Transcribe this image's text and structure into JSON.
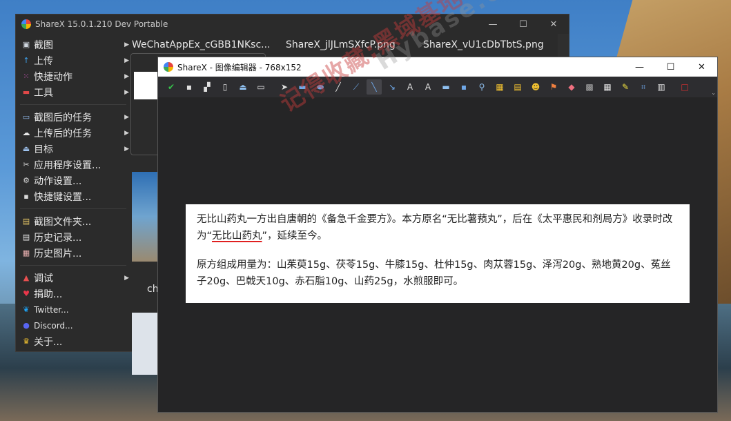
{
  "main_window": {
    "title": "ShareX 15.0.1.210 Dev Portable",
    "controls": [
      "—",
      "☐",
      "✕"
    ],
    "menu": [
      {
        "icon": "camera-icon",
        "glyph": "▣",
        "color": "#cfd6de",
        "label": "截图",
        "arrow": true
      },
      {
        "icon": "upload-icon",
        "glyph": "↑",
        "color": "#3fa4f0",
        "label": "上传",
        "arrow": true
      },
      {
        "icon": "quick-actions-icon",
        "glyph": "⁙",
        "color": "#e85bd0",
        "label": "快捷动作",
        "arrow": true
      },
      {
        "icon": "toolbox-icon",
        "glyph": "▬",
        "color": "#e04848",
        "label": "工具",
        "arrow": true
      },
      {
        "sep": true
      },
      {
        "icon": "after-capture-icon",
        "glyph": "▭",
        "color": "#8fb8e8",
        "label": "截图后的任务",
        "arrow": true
      },
      {
        "icon": "cloud-upload-icon",
        "glyph": "☁",
        "color": "#e8e8e8",
        "label": "上传后的任务",
        "arrow": true
      },
      {
        "icon": "destinations-icon",
        "glyph": "⏏",
        "color": "#9fc4f0",
        "label": "目标",
        "arrow": true
      },
      {
        "icon": "app-settings-icon",
        "glyph": "✂",
        "color": "#d9d9d9",
        "label": "应用程序设置...",
        "arrow": false
      },
      {
        "icon": "task-settings-icon",
        "glyph": "⚙",
        "color": "#d9d9d9",
        "label": "动作设置...",
        "arrow": false
      },
      {
        "icon": "hotkey-settings-icon",
        "glyph": "▪",
        "color": "#d9d9d9",
        "label": "快捷键设置...",
        "arrow": false
      },
      {
        "sep": true
      },
      {
        "icon": "folder-icon",
        "glyph": "▤",
        "color": "#e8c867",
        "label": "截图文件夹...",
        "arrow": false
      },
      {
        "icon": "history-icon",
        "glyph": "▤",
        "color": "#e8e8e8",
        "label": "历史记录...",
        "arrow": false
      },
      {
        "icon": "image-history-icon",
        "glyph": "▦",
        "color": "#e8b0b0",
        "label": "历史图片...",
        "arrow": false
      },
      {
        "sep": true
      },
      {
        "icon": "debug-icon",
        "glyph": "▲",
        "color": "#e85050",
        "label": "调试",
        "arrow": true
      },
      {
        "icon": "heart-icon",
        "glyph": "♥",
        "color": "#e8364a",
        "label": "捐助...",
        "arrow": false
      },
      {
        "icon": "twitter-icon",
        "glyph": "❦",
        "color": "#1da1f2",
        "label": "Twitter...",
        "arrow": false,
        "small": true
      },
      {
        "icon": "discord-icon",
        "glyph": "●",
        "color": "#5865f2",
        "label": "Discord...",
        "arrow": false,
        "small": true
      },
      {
        "icon": "crown-icon",
        "glyph": "♛",
        "color": "#f2c230",
        "label": "关于...",
        "arrow": false
      }
    ],
    "thumbnails": [
      {
        "label": "WeChatAppEx_cGBB1NKsc..."
      },
      {
        "label": "ShareX_jlJLmSXfcP.png"
      },
      {
        "label": "ShareX_vU1cDbTbtS.png"
      }
    ],
    "thumb2_label": "ch"
  },
  "editor": {
    "title": "ShareX - 图像编辑器 - 768x152",
    "controls": [
      "—",
      "☐",
      "✕"
    ],
    "tools": [
      {
        "name": "confirm-icon",
        "glyph": "✔",
        "color": "#35c24a"
      },
      {
        "name": "save-icon",
        "glyph": "▪",
        "color": "#e0e0e0"
      },
      {
        "name": "save-as-icon",
        "glyph": "▞",
        "color": "#e0e0e0"
      },
      {
        "name": "copy-icon",
        "glyph": "▯",
        "color": "#e0e0e0"
      },
      {
        "name": "upload-icon",
        "glyph": "⏏",
        "color": "#8fc0f0"
      },
      {
        "name": "print-icon",
        "glyph": "▭",
        "color": "#e0e0e0"
      },
      {
        "sep": true
      },
      {
        "name": "select-icon",
        "glyph": "➤",
        "color": "#e0e0e0"
      },
      {
        "name": "rectangle-icon",
        "glyph": "▬",
        "color": "#6fa8e8"
      },
      {
        "name": "ellipse-icon",
        "glyph": "⬬",
        "color": "#6fa8e8"
      },
      {
        "name": "freehand-icon",
        "glyph": "╱",
        "color": "#e0e0e0"
      },
      {
        "name": "smart-pen-icon",
        "glyph": "⟋",
        "color": "#6fa8e8"
      },
      {
        "name": "line-icon",
        "glyph": "╲",
        "color": "#6fa8e8",
        "active": true
      },
      {
        "name": "arrow-icon",
        "glyph": "↘",
        "color": "#6fa8e8"
      },
      {
        "name": "text-outline-icon",
        "glyph": "A",
        "color": "#e0e0e0"
      },
      {
        "name": "text-background-icon",
        "glyph": "A",
        "color": "#e0e0e0"
      },
      {
        "name": "speech-balloon-icon",
        "glyph": "▬",
        "color": "#8fc0f0"
      },
      {
        "name": "step-icon",
        "glyph": "▪",
        "color": "#6fa8e8"
      },
      {
        "name": "magnify-icon",
        "glyph": "⚲",
        "color": "#8fc0f0"
      },
      {
        "name": "image-icon",
        "glyph": "▦",
        "color": "#f0c030"
      },
      {
        "name": "image-screen-icon",
        "glyph": "▤",
        "color": "#f0c030"
      },
      {
        "name": "sticker-icon",
        "glyph": "☻",
        "color": "#f0c030"
      },
      {
        "name": "cursor-icon",
        "glyph": "⚑",
        "color": "#f08040"
      },
      {
        "name": "eraser-icon",
        "glyph": "◆",
        "color": "#f07080"
      },
      {
        "name": "blur-icon",
        "glyph": "▩",
        "color": "#b0b0b0"
      },
      {
        "name": "pixelate-icon",
        "glyph": "▦",
        "color": "#e0e0e0"
      },
      {
        "name": "highlight-icon",
        "glyph": "✎",
        "color": "#f0e040"
      },
      {
        "name": "crop-icon",
        "glyph": "⌗",
        "color": "#6fa8e8"
      },
      {
        "name": "cut-out-icon",
        "glyph": "▥",
        "color": "#e0e0e0"
      },
      {
        "sep": true
      },
      {
        "name": "border-color-icon",
        "glyph": "□",
        "color": "#e03030"
      }
    ],
    "overflow": "⌄"
  },
  "document": {
    "para1_before": "无比山药丸一方出自唐朝的《备急千金要方》。本方原名“无比薯蓣丸”，后在《太平惠民和剂局方》收录时改为“",
    "para1_underlined": "无比山药丸",
    "para1_after": "”，延续至今。",
    "para2": "原方组成用量为：山茱萸15g、茯苓15g、牛膝15g、杜仲15g、肉苁蓉15g、泽泻20g、熟地黄20g、菟丝子20g、巴戟天10g、赤石脂10g、山药25g，水煎服即可。"
  },
  "watermark": {
    "line1": "记得收藏:黑域基地",
    "line2": "Hybase.com"
  }
}
